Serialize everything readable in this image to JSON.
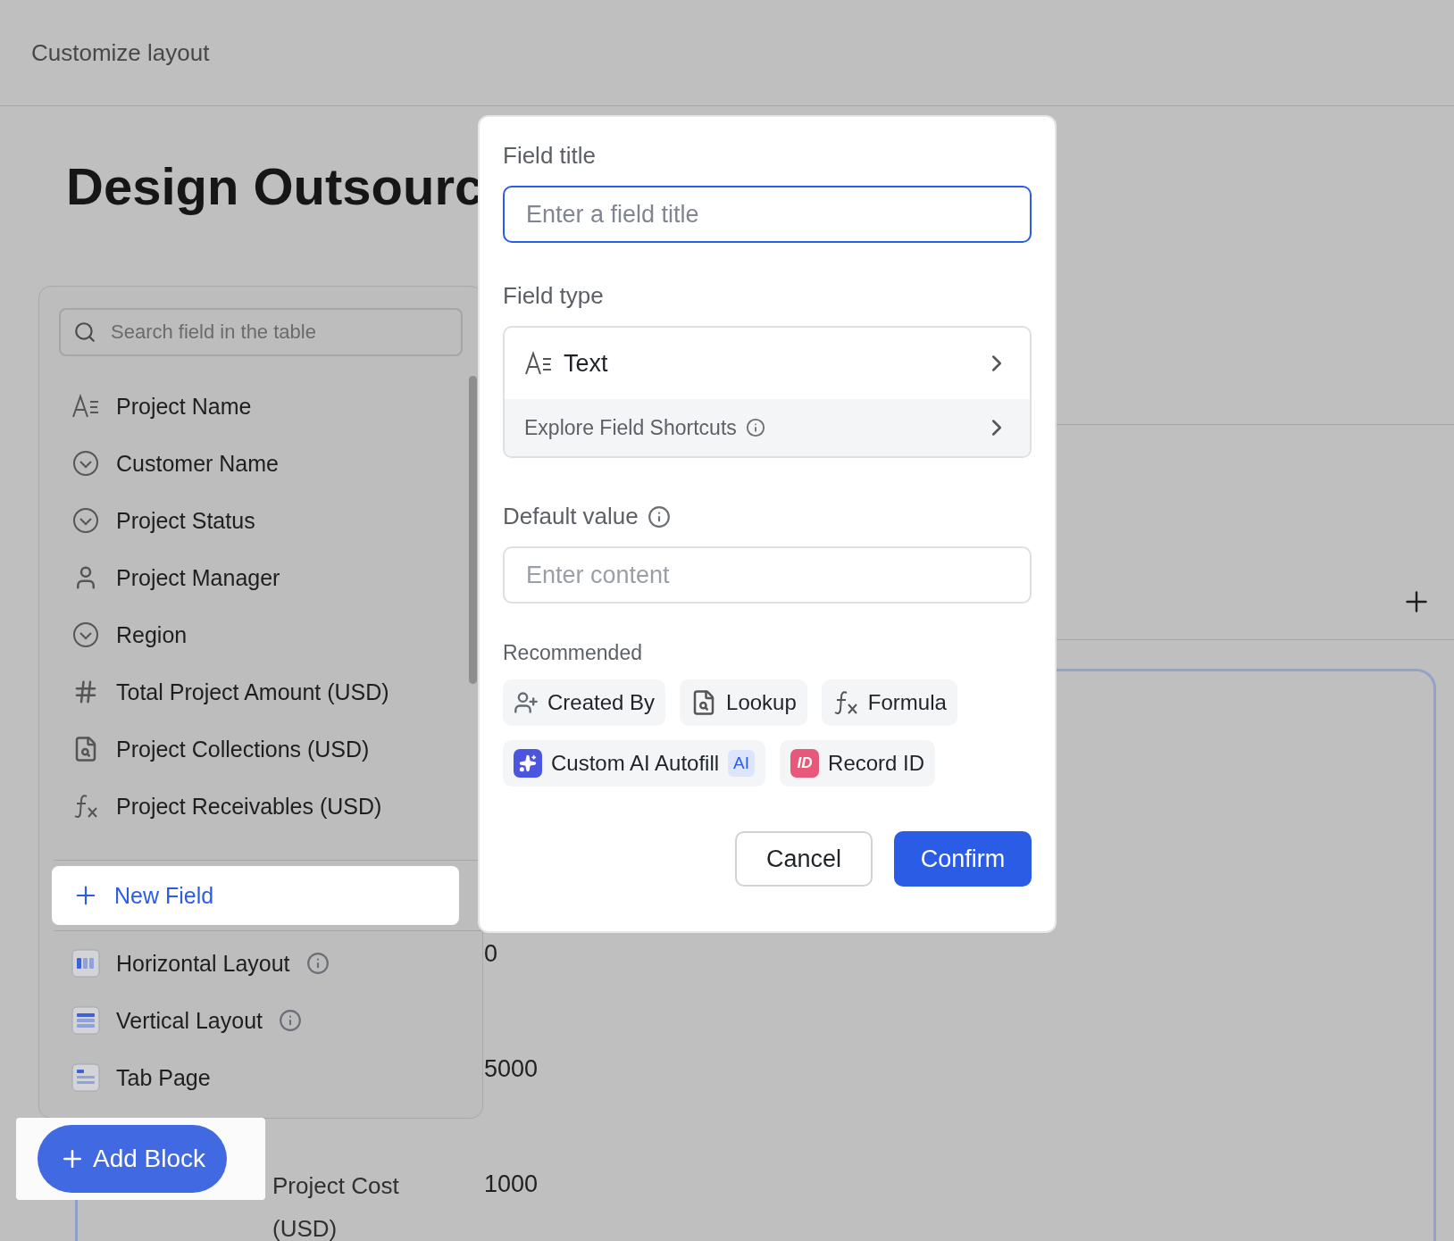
{
  "header": {
    "title": "Customize layout"
  },
  "page": {
    "title": "Design Outsourc",
    "values": [
      "0",
      "5000",
      "1000"
    ],
    "row_label": [
      "Project Cost",
      "(USD)"
    ]
  },
  "field_panel": {
    "search_placeholder": "Search field in the table",
    "fields": [
      {
        "kind": "text",
        "name": "Project Name"
      },
      {
        "kind": "option",
        "name": "Customer Name"
      },
      {
        "kind": "option",
        "name": "Project Status"
      },
      {
        "kind": "person",
        "name": "Project Manager"
      },
      {
        "kind": "option",
        "name": "Region"
      },
      {
        "kind": "number",
        "name": "Total Project Amount (USD)"
      },
      {
        "kind": "lookup",
        "name": "Project Collections (USD)"
      },
      {
        "kind": "formula",
        "name": "Project Receivables (USD)"
      }
    ],
    "new_field": "New Field",
    "layouts": [
      {
        "kind": "horizontal",
        "name": "Horizontal Layout",
        "info": true
      },
      {
        "kind": "vertical",
        "name": "Vertical Layout",
        "info": true
      },
      {
        "kind": "tab",
        "name": "Tab Page",
        "info": false
      }
    ]
  },
  "dialog": {
    "field_title": {
      "label": "Field title",
      "placeholder": "Enter a field title"
    },
    "field_type": {
      "label": "Field type",
      "value": "Text",
      "shortcuts": "Explore Field Shortcuts"
    },
    "default_value": {
      "label": "Default value",
      "placeholder": "Enter content"
    },
    "recommended": {
      "label": "Recommended",
      "items": [
        {
          "kind": "person-add",
          "label": "Created By"
        },
        {
          "kind": "lookup",
          "label": "Lookup"
        },
        {
          "kind": "formula",
          "label": "Formula"
        },
        {
          "kind": "ai",
          "label": "Custom AI Autofill",
          "tag": "AI"
        },
        {
          "kind": "id",
          "icon_text": "ID",
          "label": "Record ID"
        }
      ]
    },
    "cancel": "Cancel",
    "confirm": "Confirm"
  },
  "add_block": "Add Block"
}
